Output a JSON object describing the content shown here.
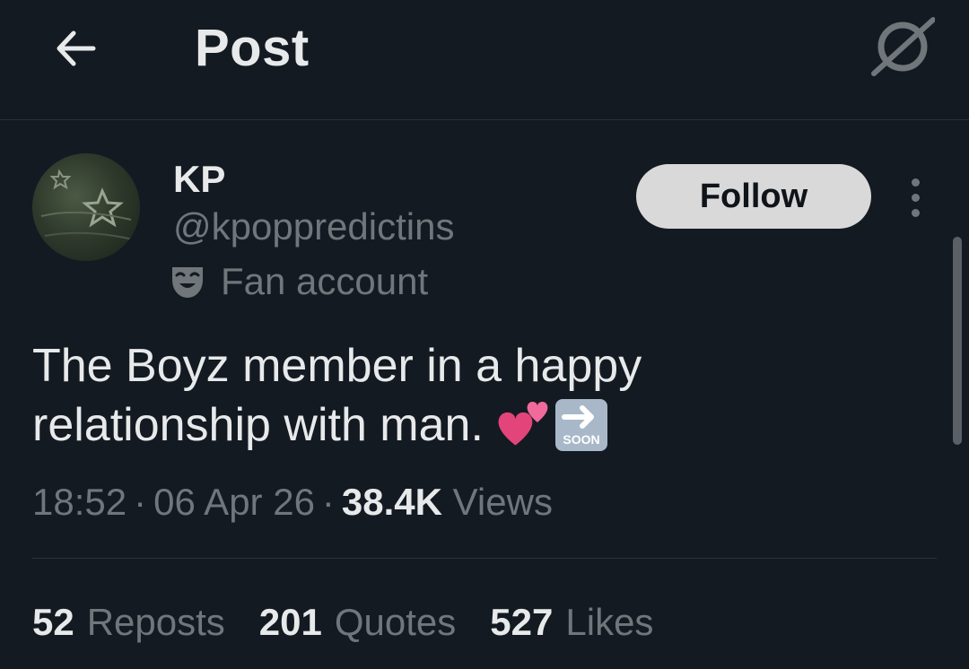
{
  "header": {
    "title": "Post",
    "back_icon": "arrow-left-icon",
    "grok_icon": "grok-icon"
  },
  "author": {
    "name": "KP",
    "handle": "@kpoppredictins",
    "affiliation_label": "Fan account",
    "affiliation_icon": "theater-mask-icon",
    "follow_label": "Follow",
    "more_icon": "more-vertical-icon"
  },
  "post": {
    "text_line1": "The Boyz member in a happy",
    "text_line2": "relationship with man.",
    "emojis": [
      "two-hearts-emoji",
      "soon-arrow-emoji"
    ]
  },
  "meta": {
    "time": "18:52",
    "date": "06 Apr 26",
    "views_count": "38.4K",
    "views_label": "Views"
  },
  "stats": {
    "reposts_count": "52",
    "reposts_label": "Reposts",
    "quotes_count": "201",
    "quotes_label": "Quotes",
    "likes_count": "527",
    "likes_label": "Likes"
  },
  "colors": {
    "background": "#141a22",
    "primary_text": "#e7e9ea",
    "secondary_text": "#71767b",
    "follow_button_bg": "#d9d9d9",
    "divider": "#2b3138"
  }
}
